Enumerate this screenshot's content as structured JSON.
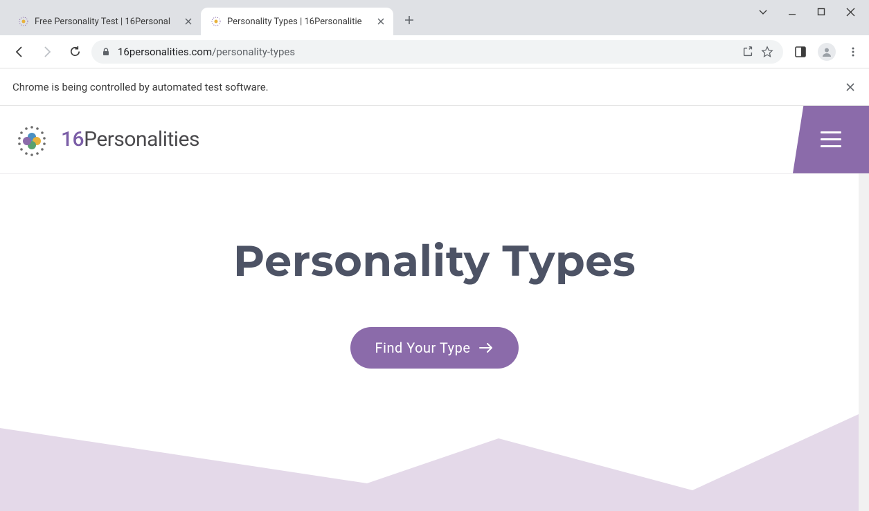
{
  "browser": {
    "tabs": [
      {
        "title": "Free Personality Test | 16Personal",
        "active": false
      },
      {
        "title": "Personality Types | 16Personalitie",
        "active": true
      }
    ],
    "url_host": "16personalities.com",
    "url_path": "/personality-types"
  },
  "infobar": {
    "message": "Chrome is being controlled by automated test software."
  },
  "site": {
    "logo_prefix": "16",
    "logo_text": "Personalities"
  },
  "hero": {
    "title": "Personality Types",
    "cta_label": "Find Your Type"
  }
}
